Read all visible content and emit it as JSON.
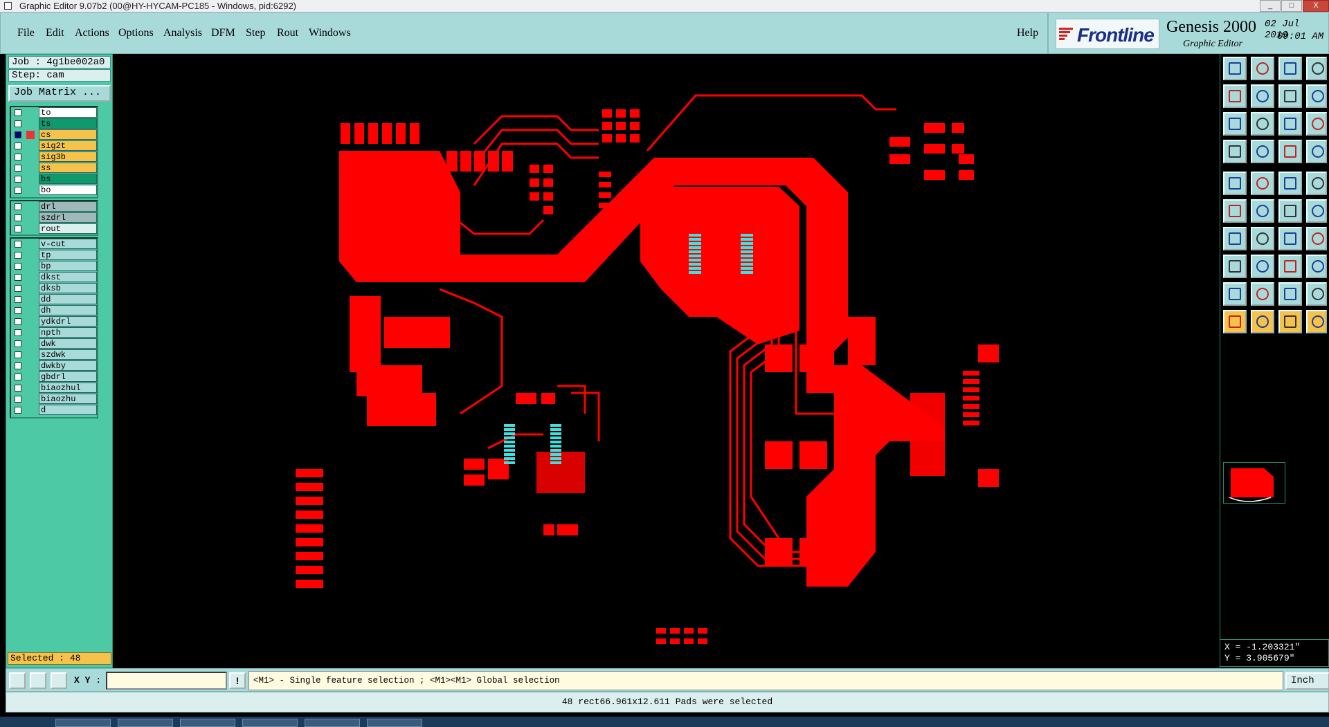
{
  "window": {
    "title": "Graphic Editor 9.07b2 (00@HY-HYCAM-PC185 - Windows, pid:6292)",
    "minimize": "_",
    "maximize": "□",
    "close": "X"
  },
  "menu": {
    "file": "File",
    "edit": "Edit",
    "actions": "Actions",
    "options": "Options",
    "analysis": "Analysis",
    "dfm": "DFM",
    "step": "Step",
    "rout": "Rout",
    "windows": "Windows",
    "help": "Help"
  },
  "brand": {
    "logo": "Frontline",
    "product": "Genesis 2000",
    "subtitle": "Graphic Editor",
    "date": "02 Jul 2019",
    "time": "09:01 AM"
  },
  "job": {
    "job_label": "Job : 4g1be002a0",
    "step_label": "Step: cam",
    "matrix_button": "Job Matrix ..."
  },
  "layers": {
    "board": [
      {
        "name": "to",
        "color": "#ffffff",
        "affected": false,
        "work": false
      },
      {
        "name": "ts",
        "color": "#0e9a6a",
        "affected": false,
        "work": false
      },
      {
        "name": "cs",
        "color": "#f5c24a",
        "affected": true,
        "work": true
      },
      {
        "name": "sig2t",
        "color": "#f5c24a",
        "affected": false,
        "work": false
      },
      {
        "name": "sig3b",
        "color": "#f5c24a",
        "affected": false,
        "work": false
      },
      {
        "name": "ss",
        "color": "#f5c24a",
        "affected": false,
        "work": false
      },
      {
        "name": "bs",
        "color": "#0e9a6a",
        "affected": false,
        "work": false
      },
      {
        "name": "bo",
        "color": "#ffffff",
        "affected": false,
        "work": false
      }
    ],
    "drill": [
      {
        "name": "drl",
        "color": "#9fb8b8"
      },
      {
        "name": "szdrl",
        "color": "#9fb8b8"
      },
      {
        "name": "rout",
        "color": "#dcefef"
      }
    ],
    "misc": [
      {
        "name": "v-cut"
      },
      {
        "name": "tp"
      },
      {
        "name": "bp"
      },
      {
        "name": "dkst"
      },
      {
        "name": "dksb"
      },
      {
        "name": "dd"
      },
      {
        "name": "dh"
      },
      {
        "name": "ydkdrl"
      },
      {
        "name": "npth"
      },
      {
        "name": "dwk"
      },
      {
        "name": "szdwk"
      },
      {
        "name": "dwkby"
      },
      {
        "name": "gbdrl"
      },
      {
        "name": "biaozhul"
      },
      {
        "name": "biaozhu"
      },
      {
        "name": "d"
      }
    ]
  },
  "selection": {
    "selected_label": "Selected : 48"
  },
  "coordinates": {
    "x": "X = -1.203321\"",
    "y": "Y = 3.905679\""
  },
  "command": {
    "xy_label": "X Y :",
    "xy_value": "",
    "exclaim": "!",
    "hint": "<M1> - Single feature selection ; <M1><M1> Global selection",
    "units": "Inch"
  },
  "status": {
    "message": "48 rect66.961x12.611 Pads were selected"
  },
  "colors": {
    "copper": "#ff0000",
    "selected_pads": "#3fe0e0",
    "panel": "#4ec9a6",
    "menubar": "#a9dada"
  }
}
